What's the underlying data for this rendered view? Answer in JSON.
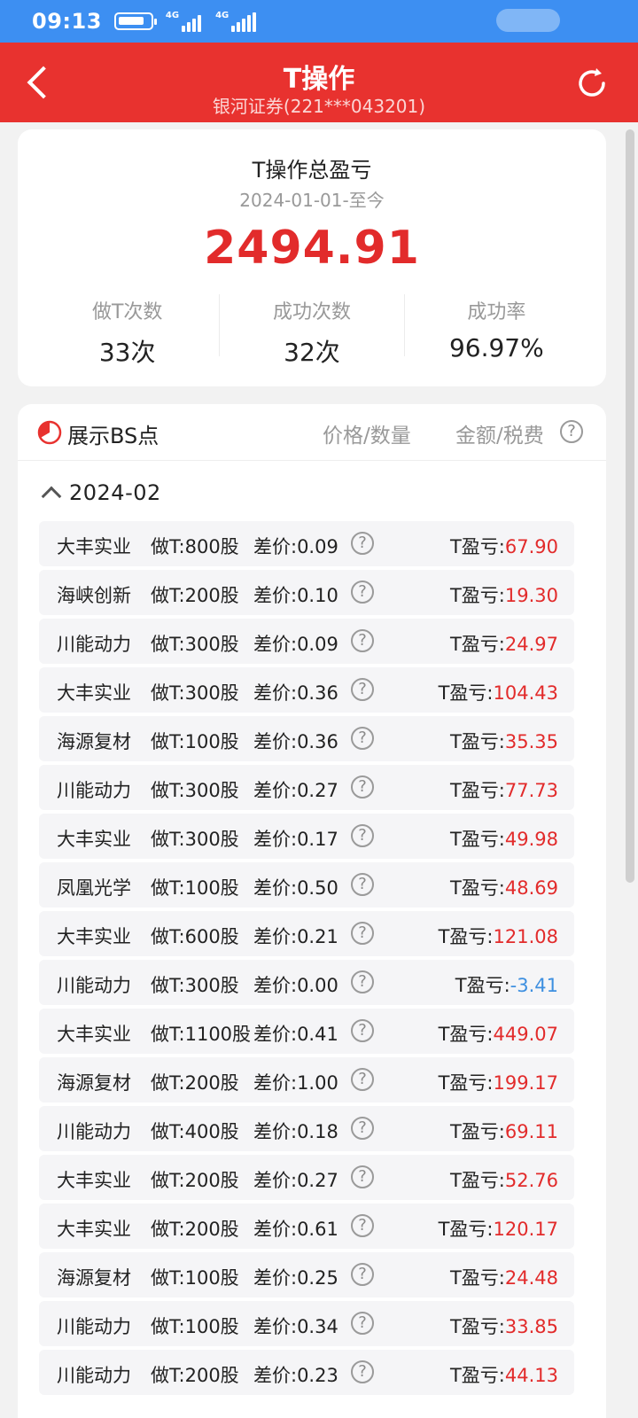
{
  "status_bar": {
    "time": "09:13",
    "network_1": "4G",
    "network_2": "4G"
  },
  "nav": {
    "title": "T操作",
    "subtitle": "银河证券(221***043201)"
  },
  "summary": {
    "title": "T操作总盈亏",
    "period": "2024-01-01-至今",
    "total": "2494.91",
    "stats": [
      {
        "label": "做T次数",
        "value": "33次"
      },
      {
        "label": "成功次数",
        "value": "32次"
      },
      {
        "label": "成功率",
        "value": "96.97%"
      }
    ]
  },
  "list": {
    "show_bs_label": "展示BS点",
    "col_price": "价格/数量",
    "col_amount": "金额/税费",
    "help_glyph": "?",
    "month": "2024-02",
    "profit_label": "T盈亏:",
    "rows": [
      {
        "name": "大丰实业",
        "qty": "做T:800股",
        "diff": "差价:0.09",
        "profit": "67.90"
      },
      {
        "name": "海峡创新",
        "qty": "做T:200股",
        "diff": "差价:0.10",
        "profit": "19.30"
      },
      {
        "name": "川能动力",
        "qty": "做T:300股",
        "diff": "差价:0.09",
        "profit": "24.97"
      },
      {
        "name": "大丰实业",
        "qty": "做T:300股",
        "diff": "差价:0.36",
        "profit": "104.43"
      },
      {
        "name": "海源复材",
        "qty": "做T:100股",
        "diff": "差价:0.36",
        "profit": "35.35"
      },
      {
        "name": "川能动力",
        "qty": "做T:300股",
        "diff": "差价:0.27",
        "profit": "77.73"
      },
      {
        "name": "大丰实业",
        "qty": "做T:300股",
        "diff": "差价:0.17",
        "profit": "49.98"
      },
      {
        "name": "凤凰光学",
        "qty": "做T:100股",
        "diff": "差价:0.50",
        "profit": "48.69"
      },
      {
        "name": "大丰实业",
        "qty": "做T:600股",
        "diff": "差价:0.21",
        "profit": "121.08"
      },
      {
        "name": "川能动力",
        "qty": "做T:300股",
        "diff": "差价:0.00",
        "profit": "-3.41"
      },
      {
        "name": "大丰实业",
        "qty": "做T:1100股",
        "diff": "差价:0.41",
        "profit": "449.07"
      },
      {
        "name": "海源复材",
        "qty": "做T:200股",
        "diff": "差价:1.00",
        "profit": "199.17"
      },
      {
        "name": "川能动力",
        "qty": "做T:400股",
        "diff": "差价:0.18",
        "profit": "69.11"
      },
      {
        "name": "大丰实业",
        "qty": "做T:200股",
        "diff": "差价:0.27",
        "profit": "52.76"
      },
      {
        "name": "大丰实业",
        "qty": "做T:200股",
        "diff": "差价:0.61",
        "profit": "120.17"
      },
      {
        "name": "海源复材",
        "qty": "做T:100股",
        "diff": "差价:0.25",
        "profit": "24.48"
      },
      {
        "name": "川能动力",
        "qty": "做T:100股",
        "diff": "差价:0.34",
        "profit": "33.85"
      },
      {
        "name": "川能动力",
        "qty": "做T:200股",
        "diff": "差价:0.23",
        "profit": "44.13"
      }
    ]
  },
  "colors": {
    "brand_red": "#e8322f",
    "status_blue": "#3d8ff2",
    "profit_red": "#e22b2b",
    "loss_blue": "#3d8fe0"
  }
}
